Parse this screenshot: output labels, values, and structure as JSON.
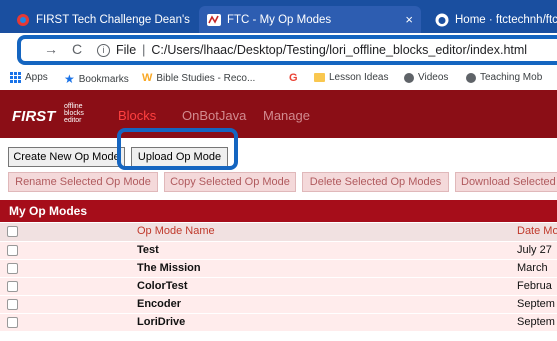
{
  "browser": {
    "tabs": [
      {
        "title": "FIRST Tech Challenge Dean's List",
        "icon": "first-logo-icon",
        "close": "×"
      },
      {
        "title": "FTC - My Op Modes",
        "icon": "ftc-logo-icon",
        "close": "×"
      },
      {
        "title": "Home · ftctechnh/ftc_ap",
        "icon": "github-icon",
        "close": ""
      }
    ],
    "nav": {
      "back": "←",
      "forward": "→",
      "reload": "C"
    },
    "address": {
      "scheme_label": "File",
      "path": "C:/Users/lhaac/Desktop/Testing/lori_offline_blocks_editor/index.html"
    },
    "bookmarks": [
      {
        "label": "Apps",
        "icon": "apps-grid-icon"
      },
      {
        "label": "Bookmarks",
        "icon": "star-icon"
      },
      {
        "label": "Bible Studies - Reco...",
        "icon": "w-logo-icon"
      },
      {
        "label": "",
        "icon": "google-icon"
      },
      {
        "label": "Lesson Ideas",
        "icon": "folder-icon"
      },
      {
        "label": "Videos",
        "icon": "globe-icon"
      },
      {
        "label": "Teaching Mob",
        "icon": "globe-icon"
      }
    ]
  },
  "app": {
    "logo": "FIRST",
    "logo_sub": [
      "offline",
      "blocks",
      "editor"
    ],
    "nav": [
      "Blocks",
      "OnBotJava",
      "Manage"
    ],
    "buttons_row1": [
      "Create New Op Mode",
      "Upload Op Mode"
    ],
    "buttons_row2": [
      "Rename Selected Op Mode",
      "Copy Selected Op Mode",
      "Delete Selected Op Modes",
      "Download Selected"
    ],
    "section_title": "My Op Modes",
    "table": {
      "headers": [
        "Op Mode Name",
        "Date Mo"
      ],
      "rows": [
        {
          "name": "Test",
          "date": "July 27"
        },
        {
          "name": "The Mission",
          "date": "March"
        },
        {
          "name": "ColorTest",
          "date": "Februa"
        },
        {
          "name": "Encoder",
          "date": "Septem"
        },
        {
          "name": "LoriDrive",
          "date": "Septem"
        }
      ]
    }
  },
  "colors": {
    "tab_bar": "#1a4fa0",
    "app_bar": "#8b0e16",
    "section_bar": "#a60d1a",
    "highlight": "#1565c0",
    "row_bg": "#ffecec"
  }
}
